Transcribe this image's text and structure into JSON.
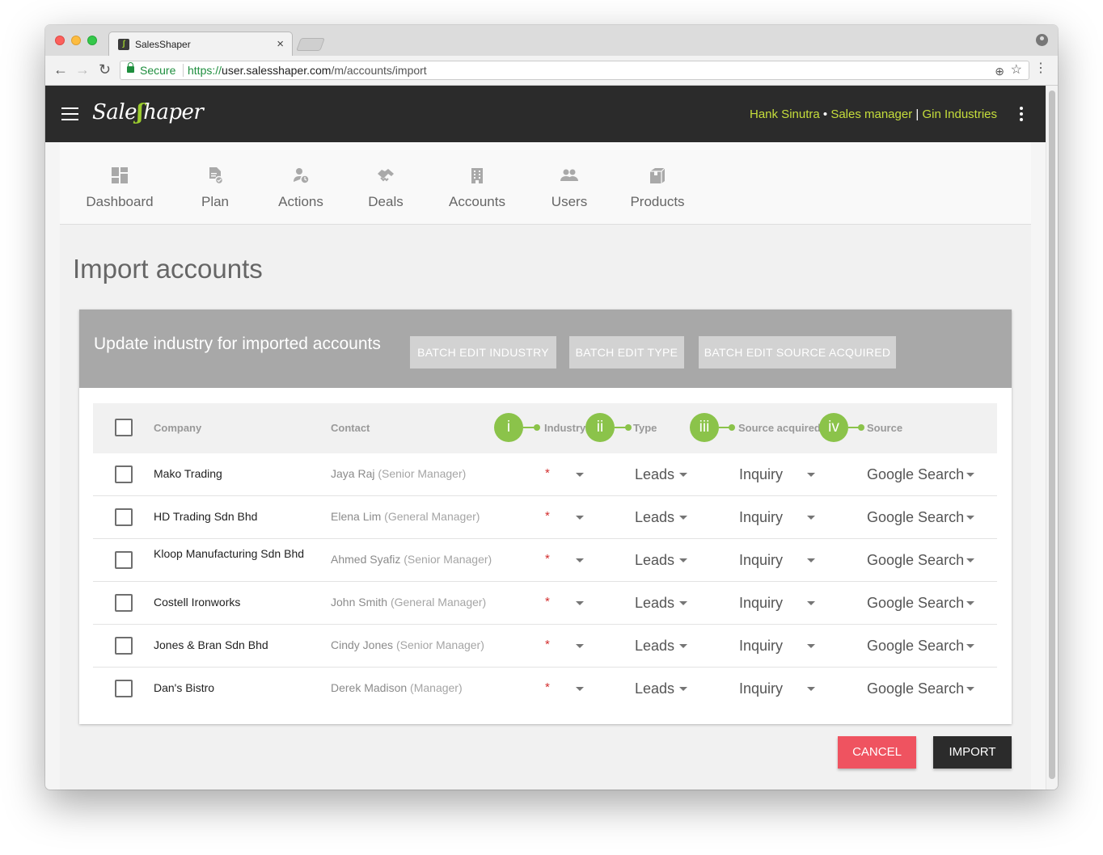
{
  "browser": {
    "tab_title": "SalesShaper",
    "tab_close": "×",
    "secure_label": "Secure",
    "url_scheme": "https://",
    "url_host": "user.salesshaper.com",
    "url_path": "/m/accounts/import"
  },
  "app": {
    "logo_part1": "Sale",
    "logo_part2": "haper",
    "user_name": "Hank Sinutra",
    "user_sep": " • ",
    "user_role": "Sales manager",
    "company_sep": " | ",
    "user_company": "Gin Industries"
  },
  "nav": {
    "items": [
      {
        "label": "Dashboard",
        "icon": "dashboard-icon"
      },
      {
        "label": "Plan",
        "icon": "plan-icon"
      },
      {
        "label": "Actions",
        "icon": "actions-icon"
      },
      {
        "label": "Deals",
        "icon": "deals-icon"
      },
      {
        "label": "Accounts",
        "icon": "accounts-icon"
      },
      {
        "label": "Users",
        "icon": "users-icon"
      },
      {
        "label": "Products",
        "icon": "products-icon"
      }
    ]
  },
  "page": {
    "title": "Import accounts"
  },
  "card": {
    "title": "Update industry for imported accounts",
    "batch_industry": "BATCH EDIT INDUSTRY",
    "batch_type": "BATCH EDIT TYPE",
    "batch_source": "BATCH EDIT SOURCE ACQUIRED"
  },
  "table": {
    "headers": {
      "company": "Company",
      "contact": "Contact",
      "industry": "Industry",
      "type": "Type",
      "source_acquired": "Source acquired",
      "source": "Source"
    },
    "steps": [
      "i",
      "ii",
      "iii",
      "iv"
    ],
    "required_mark": "*",
    "rows": [
      {
        "company": "Mako Trading",
        "contact_name": "Jaya Raj",
        "contact_role": "(Senior Manager)",
        "type": "Leads",
        "source_acquired": "Inquiry",
        "source": "Google Search"
      },
      {
        "company": "HD Trading Sdn Bhd",
        "contact_name": "Elena Lim",
        "contact_role": "(General Manager)",
        "type": "Leads",
        "source_acquired": "Inquiry",
        "source": "Google Search"
      },
      {
        "company": "Kloop Manufacturing Sdn Bhd",
        "contact_name": "Ahmed Syafiz",
        "contact_role": "(Senior Manager)",
        "type": "Leads",
        "source_acquired": "Inquiry",
        "source": "Google Search"
      },
      {
        "company": "Costell Ironworks",
        "contact_name": "John Smith",
        "contact_role": "(General Manager)",
        "type": "Leads",
        "source_acquired": "Inquiry",
        "source": "Google Search"
      },
      {
        "company": "Jones & Bran Sdn Bhd",
        "contact_name": "Cindy Jones",
        "contact_role": "(Senior Manager)",
        "type": "Leads",
        "source_acquired": "Inquiry",
        "source": "Google Search"
      },
      {
        "company": "Dan's Bistro",
        "contact_name": "Derek Madison",
        "contact_role": "(Manager)",
        "type": "Leads",
        "source_acquired": "Inquiry",
        "source": "Google Search"
      }
    ]
  },
  "actions": {
    "cancel": "CANCEL",
    "import": "IMPORT"
  },
  "colors": {
    "appbar": "#2b2b2b",
    "accent_green": "#8bc34a",
    "user_info": "#c6de3b",
    "cancel": "#ef5360",
    "card_header": "#a8a8a8"
  }
}
